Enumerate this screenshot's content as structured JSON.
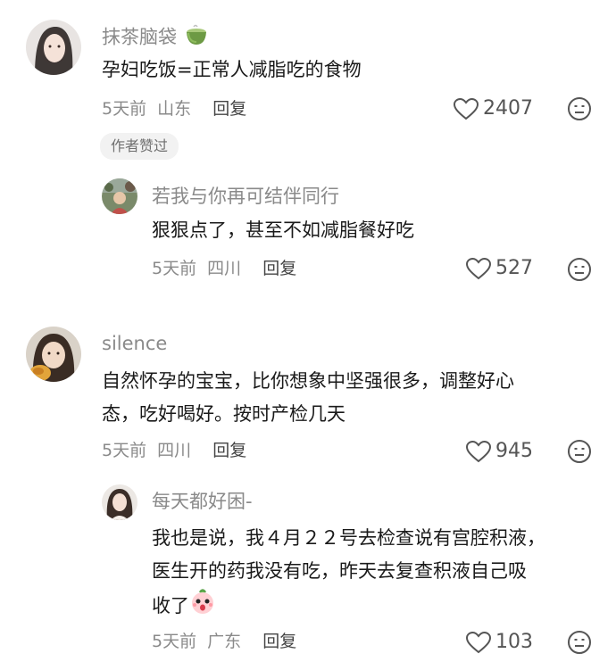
{
  "comments": [
    {
      "username": "抹茶脑袋",
      "text_lines": [
        "孕妇吃饭=正常人减脂吃的食物"
      ],
      "time": "5天前",
      "location": "山东",
      "reply_label": "回复",
      "likes": "2407",
      "badge": "作者赞过",
      "emoji_icon": "matcha-cup-icon",
      "replies": [
        {
          "username": "若我与你再可结伴同行",
          "text_lines": [
            "狠狠点了，甚至不如减脂餐好吃"
          ],
          "time": "5天前",
          "location": "四川",
          "reply_label": "回复",
          "likes": "527"
        }
      ]
    },
    {
      "username": "silence",
      "text_lines": [
        "自然怀孕的宝宝，比你想象中坚强很多，调整好心",
        "态，吃好喝好。按时产检几天"
      ],
      "time": "5天前",
      "location": "四川",
      "reply_label": "回复",
      "likes": "945",
      "replies": [
        {
          "username": "每天都好困-",
          "text_lines": [
            "我也是说，我４月２２号去检查说有宫腔积液，",
            "医生开的药我没有吃，昨天去复查积液自己吸",
            "收了"
          ],
          "time": "5天前",
          "location": "广东",
          "reply_label": "回复",
          "likes": "103",
          "emoji_icon": "surprised-face-icon"
        }
      ]
    }
  ],
  "colors": {
    "muted": "#8a8a8a",
    "text": "#1a1a1a",
    "badge_bg": "#f2f2f2"
  }
}
